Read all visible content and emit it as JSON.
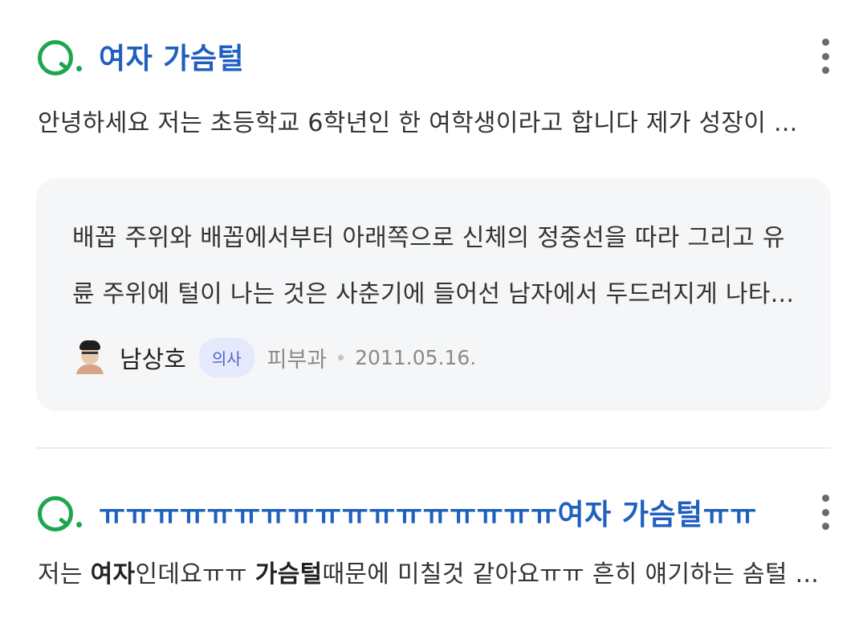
{
  "results": [
    {
      "badge": "Q.",
      "title": "여자 가슴털",
      "snippet_parts": [
        {
          "text": "안녕하세요 저는 초등학교 6학년인 한 여학생이라고 합니다 제가 성장이 ...",
          "bold": false
        }
      ],
      "answer": {
        "line1": "배꼽 주위와 배꼽에서부터 아래쪽으로 신체의 정중선을 따라 그리고 유",
        "line2": "륜 주위에 털이 나는 것은 사춘기에 들어선 남자에서 두드러지게 나타...",
        "author": "남상호",
        "role": "의사",
        "department": "피부과",
        "date": "2011.05.16."
      }
    },
    {
      "badge": "Q.",
      "title": "ㅠㅠㅠㅠㅠㅠㅠㅠㅠㅠㅠㅠㅠㅠㅠㅠㅠ여자 가슴털ㅠㅠ",
      "snippet_parts": [
        {
          "text": "저는 ",
          "bold": false
        },
        {
          "text": "여자",
          "bold": true
        },
        {
          "text": "인데요ㅠㅠ ",
          "bold": false
        },
        {
          "text": "가슴털",
          "bold": true
        },
        {
          "text": "때문에 미칠것 같아요ㅠㅠ 흔히 얘기하는 솜털 ...",
          "bold": false
        }
      ]
    }
  ],
  "colors": {
    "badge_green": "#1ea64f",
    "title_blue": "#1f5fbf",
    "answer_bg": "#f5f6f8",
    "role_badge_bg": "#e4e9fb",
    "role_badge_text": "#4e63c8"
  },
  "icons": {
    "more": "more-vertical-icon",
    "avatar": "doctor-avatar"
  }
}
